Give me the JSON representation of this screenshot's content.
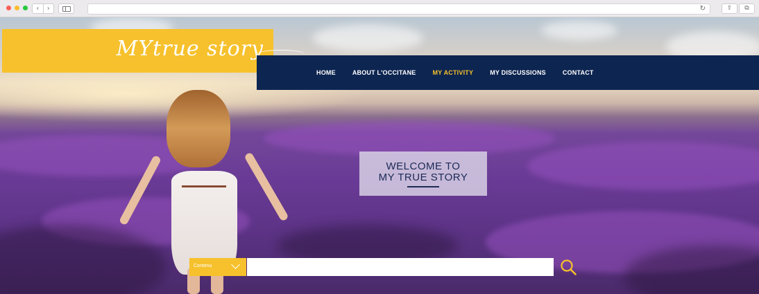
{
  "browser": {
    "back_label": "‹",
    "forward_label": "›",
    "reload_label": "↻",
    "share_label": "⇪",
    "tabs_label": "⧉"
  },
  "brand": {
    "logo_text": "MYtrue story",
    "primary_color": "#f6c12c",
    "nav_color": "#0d2551"
  },
  "nav": {
    "items": [
      {
        "label": "HOME"
      },
      {
        "label": "ABOUT L'OCCITANE"
      },
      {
        "label": "MY ACTIVITY",
        "active": true
      },
      {
        "label": "MY DISCUSSIONS"
      },
      {
        "label": "CONTACT"
      }
    ]
  },
  "welcome": {
    "line1": "WELCOME TO",
    "line2": "MY TRUE STORY"
  },
  "search": {
    "category_label": "Contenu",
    "value": "",
    "placeholder": ""
  },
  "icons": {
    "search": "search-icon",
    "dropdown": "chevron-down-icon"
  }
}
